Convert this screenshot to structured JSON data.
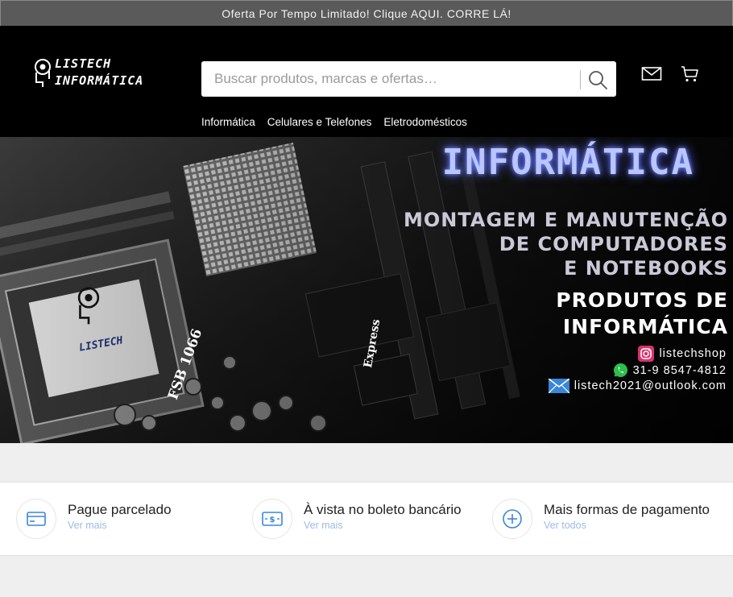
{
  "announcement": "Oferta Por Tempo Limitado! Clique AQUI. CORRE LÁ!",
  "logo": {
    "line1": "LISTECH",
    "line2": "INFORMÁTICA"
  },
  "search": {
    "placeholder": "Buscar produtos, marcas e ofertas…",
    "icon": "search-icon"
  },
  "header_icons": {
    "mail": "mail-icon",
    "cart": "cart-icon"
  },
  "nav": {
    "items": [
      "Informática",
      "Celulares e Telefones",
      "Eletrodomésticos"
    ]
  },
  "hero": {
    "title": "INFORMÁTICA",
    "subtitle_lines": [
      "MONTAGEM E MANUTENÇÃO",
      "DE COMPUTADORES",
      "E NOTEBOOKS"
    ],
    "products_lines": [
      "PRODUTOS DE",
      "INFORMÁTICA"
    ],
    "chip_labels": {
      "fsb": "FSB 1066",
      "express": "Express",
      "chip_brand": "LISTECH"
    },
    "contacts": {
      "instagram": "listechshop",
      "whatsapp": "31-9 8547-4812",
      "email": "listech2021@outlook.com"
    }
  },
  "payments": [
    {
      "title": "Pague parcelado",
      "link": "Ver mais",
      "icon": "credit-card-icon"
    },
    {
      "title": "À vista no boleto bancário",
      "link": "Ver mais",
      "icon": "cash-icon"
    },
    {
      "title": "Mais formas de pagamento",
      "link": "Ver todos",
      "icon": "plus-circle-icon"
    }
  ],
  "colors": {
    "accent": "#3a86d8",
    "link": "#9dbbe0",
    "topbar": "#5a5a5a",
    "header": "#000000"
  }
}
